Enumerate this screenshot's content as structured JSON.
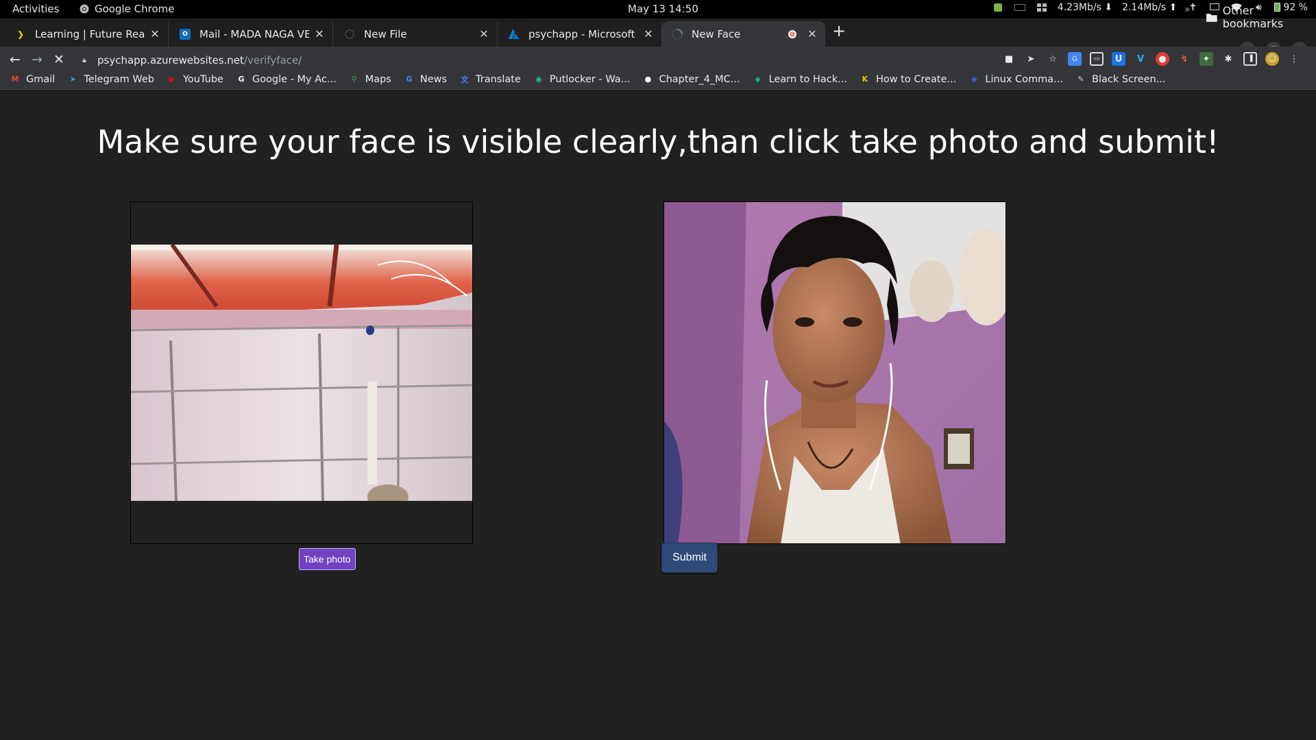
{
  "topbar": {
    "activities": "Activities",
    "app_name": "Google Chrome",
    "clock": "May 13  14:50",
    "net_down": "4.23Mb/s",
    "net_up": "2.14Mb/s",
    "battery": "92 %"
  },
  "tabs": [
    {
      "title": "Learning | Future Ready T",
      "favicon": "future-ready-icon",
      "active": false
    },
    {
      "title": "Mail - MADA NAGA VENK",
      "favicon": "outlook-icon",
      "active": false
    },
    {
      "title": "New File",
      "favicon": "blank-page-icon",
      "active": false
    },
    {
      "title": "psychapp - Microsoft Azu",
      "favicon": "azure-icon",
      "active": false
    },
    {
      "title": "New Face",
      "favicon": "loading-spinner-icon",
      "active": true,
      "recording": true
    }
  ],
  "toolbar": {
    "url_host": "psychapp.azurewebsites.net",
    "url_path": "/verifyface/"
  },
  "bookmarks": [
    {
      "label": "Gmail",
      "icon": "gmail-icon",
      "color": "#ea4335",
      "glyph": "M"
    },
    {
      "label": "Telegram Web",
      "icon": "telegram-icon",
      "color": "#2aa3df",
      "glyph": "➤"
    },
    {
      "label": "YouTube",
      "icon": "youtube-icon",
      "color": "#ff0000",
      "glyph": "▶"
    },
    {
      "label": "Google - My Ac...",
      "icon": "google-icon",
      "color": "#ffffff",
      "glyph": "G"
    },
    {
      "label": "Maps",
      "icon": "maps-icon",
      "color": "#34a853",
      "glyph": "⚲"
    },
    {
      "label": "News",
      "icon": "news-icon",
      "color": "#4285f4",
      "glyph": "G"
    },
    {
      "label": "Translate",
      "icon": "translate-icon",
      "color": "#4285f4",
      "glyph": "文"
    },
    {
      "label": "Putlocker - Wa...",
      "icon": "putlocker-icon",
      "color": "#1abc9c",
      "glyph": "◉"
    },
    {
      "label": "Chapter_4_MC...",
      "icon": "github-icon",
      "color": "#ffffff",
      "glyph": "●"
    },
    {
      "label": "Learn to Hack...",
      "icon": "hack-icon",
      "color": "#16a085",
      "glyph": "◆"
    },
    {
      "label": "How to Create...",
      "icon": "k-icon",
      "color": "#f1c40f",
      "glyph": "K"
    },
    {
      "label": "Linux Comma...",
      "icon": "linux-icon",
      "color": "#3b5bdb",
      "glyph": "◆"
    },
    {
      "label": "Black Screen...",
      "icon": "black-screen-icon",
      "color": "#cccccc",
      "glyph": "✎"
    }
  ],
  "other_bookmarks": "Other bookmarks",
  "page": {
    "heading": "Make sure your face is visible clearly,than click take photo and submit!",
    "take_photo_label": "Take photo",
    "submit_label": "Submit"
  },
  "colors": {
    "page_bg": "#212121",
    "take_photo_bg": "#6f42c1",
    "submit_bg": "#2e4a78"
  }
}
